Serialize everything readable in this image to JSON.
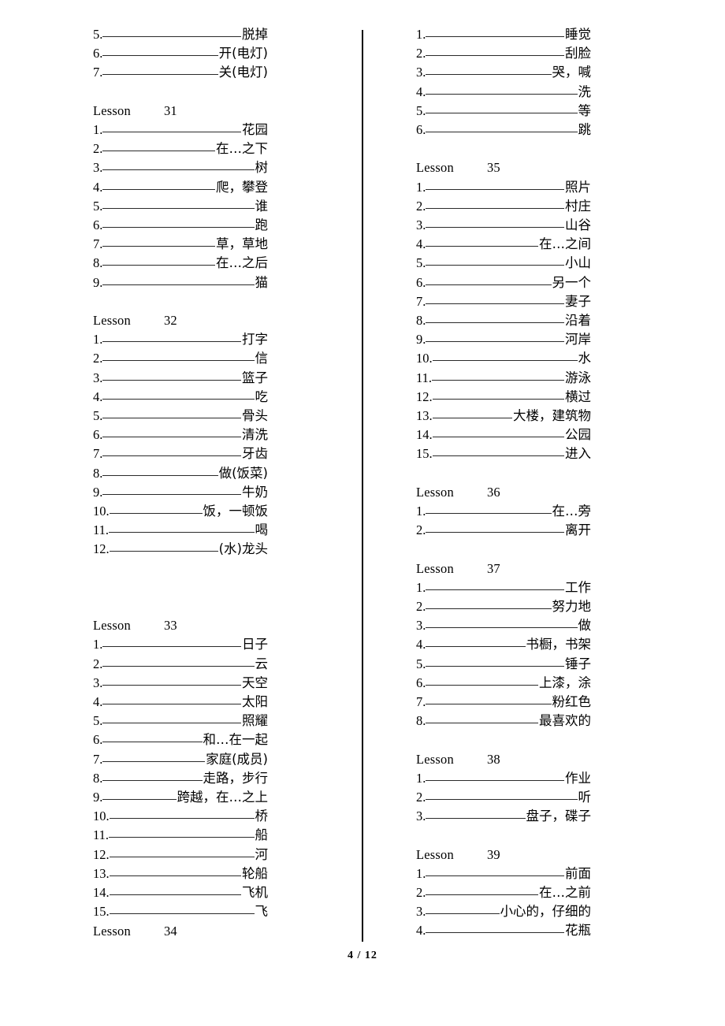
{
  "document": {
    "page_label": "4 / 12",
    "lesson_word": "Lesson"
  },
  "left_column": [
    {
      "type": "entries",
      "heading": null,
      "entries": [
        {
          "num": "5.",
          "gloss": "脱掉"
        },
        {
          "num": "6.",
          "gloss": "开(电灯)"
        },
        {
          "num": "7.",
          "gloss": "关(电灯)"
        }
      ],
      "space_after": 1
    },
    {
      "type": "lesson",
      "heading": {
        "word": "Lesson",
        "number": "31"
      },
      "entries": [
        {
          "num": "1.",
          "gloss": "花园"
        },
        {
          "num": "2.",
          "gloss": "在…之下"
        },
        {
          "num": "3.",
          "gloss": "树"
        },
        {
          "num": "4.",
          "gloss": "爬，攀登"
        },
        {
          "num": "5.",
          "gloss": "谁"
        },
        {
          "num": "6.",
          "gloss": "跑"
        },
        {
          "num": "7.",
          "gloss": "草，草地"
        },
        {
          "num": "8.",
          "gloss": "在…之后"
        },
        {
          "num": "9.",
          "gloss": "猫"
        }
      ],
      "space_after": 1
    },
    {
      "type": "lesson",
      "heading": {
        "word": "Lesson",
        "number": "32"
      },
      "entries": [
        {
          "num": "1.",
          "gloss": "打字"
        },
        {
          "num": "2.",
          "gloss": "信"
        },
        {
          "num": "3.",
          "gloss": "篮子"
        },
        {
          "num": "4.",
          "gloss": "吃"
        },
        {
          "num": "5.",
          "gloss": "骨头"
        },
        {
          "num": "6.",
          "gloss": "清洗"
        },
        {
          "num": "7.",
          "gloss": "牙齿"
        },
        {
          "num": "8.",
          "gloss": "做(饭菜)"
        },
        {
          "num": "9.",
          "gloss": "牛奶"
        },
        {
          "num": "10.",
          "gloss": "饭，一顿饭"
        },
        {
          "num": "11.",
          "gloss": "喝"
        },
        {
          "num": "12.",
          "gloss": "(水)龙头"
        }
      ],
      "space_after": 3
    },
    {
      "type": "lesson",
      "heading": {
        "word": "Lesson",
        "number": "33"
      },
      "entries": [
        {
          "num": "1.",
          "gloss": "日子"
        },
        {
          "num": "2.",
          "gloss": "云"
        },
        {
          "num": "3.",
          "gloss": "天空"
        },
        {
          "num": "4.",
          "gloss": "太阳"
        },
        {
          "num": "5.",
          "gloss": "照耀"
        },
        {
          "num": "6.",
          "gloss": "和…在一起"
        },
        {
          "num": "7.",
          "gloss": "家庭(成员)"
        },
        {
          "num": "8.",
          "gloss": "走路，步行"
        },
        {
          "num": "9.",
          "gloss": "跨越，在…之上"
        },
        {
          "num": "10.",
          "gloss": "桥"
        },
        {
          "num": "11.",
          "gloss": "船"
        },
        {
          "num": "12.",
          "gloss": "河"
        },
        {
          "num": "13.",
          "gloss": "轮船"
        },
        {
          "num": "14.",
          "gloss": "飞机"
        },
        {
          "num": "15.",
          "gloss": "飞"
        }
      ],
      "space_after": 0
    },
    {
      "type": "lesson",
      "heading": {
        "word": "Lesson",
        "number": "34"
      },
      "entries": [],
      "space_after": 0
    }
  ],
  "right_column": [
    {
      "type": "entries",
      "heading": null,
      "entries": [
        {
          "num": "1.",
          "gloss": "睡觉"
        },
        {
          "num": "2.",
          "gloss": "刮脸"
        },
        {
          "num": "3.",
          "gloss": "哭，喊"
        },
        {
          "num": "4.",
          "gloss": "洗"
        },
        {
          "num": "5.",
          "gloss": "等"
        },
        {
          "num": "6.",
          "gloss": "跳"
        }
      ],
      "space_after": 1
    },
    {
      "type": "lesson",
      "heading": {
        "word": "Lesson",
        "number": "35"
      },
      "entries": [
        {
          "num": "1.",
          "gloss": "照片"
        },
        {
          "num": "2.",
          "gloss": "村庄"
        },
        {
          "num": "3.",
          "gloss": "山谷"
        },
        {
          "num": "4.",
          "gloss": "在…之间"
        },
        {
          "num": "5.",
          "gloss": "小山"
        },
        {
          "num": "6.",
          "gloss": "另一个"
        },
        {
          "num": "7.",
          "gloss": "妻子"
        },
        {
          "num": "8.",
          "gloss": "沿着"
        },
        {
          "num": "9.",
          "gloss": "河岸"
        },
        {
          "num": "10.",
          "gloss": "水"
        },
        {
          "num": "11.",
          "gloss": "游泳"
        },
        {
          "num": "12.",
          "gloss": "横过"
        },
        {
          "num": "13.",
          "gloss": "大楼，建筑物"
        },
        {
          "num": "14.",
          "gloss": "公园"
        },
        {
          "num": "15.",
          "gloss": "进入"
        }
      ],
      "space_after": 1
    },
    {
      "type": "lesson",
      "heading": {
        "word": "Lesson",
        "number": "36"
      },
      "entries": [
        {
          "num": "1.",
          "gloss": "在…旁"
        },
        {
          "num": "2.",
          "gloss": "离开"
        }
      ],
      "space_after": 1
    },
    {
      "type": "lesson",
      "heading": {
        "word": "Lesson",
        "number": "37"
      },
      "entries": [
        {
          "num": "1.",
          "gloss": "工作"
        },
        {
          "num": "2.",
          "gloss": "努力地"
        },
        {
          "num": "3.",
          "gloss": "做"
        },
        {
          "num": "4.",
          "gloss": "书橱，书架"
        },
        {
          "num": "5.",
          "gloss": "锤子"
        },
        {
          "num": "6.",
          "gloss": "上漆，涂"
        },
        {
          "num": "7.",
          "gloss": "粉红色"
        },
        {
          "num": "8.",
          "gloss": "最喜欢的"
        }
      ],
      "space_after": 1
    },
    {
      "type": "lesson",
      "heading": {
        "word": "Lesson",
        "number": "38"
      },
      "entries": [
        {
          "num": "1.",
          "gloss": "作业"
        },
        {
          "num": "2.",
          "gloss": "听"
        },
        {
          "num": "3.",
          "gloss": "盘子，碟子"
        }
      ],
      "space_after": 1
    },
    {
      "type": "lesson",
      "heading": {
        "word": "Lesson",
        "number": "39"
      },
      "entries": [
        {
          "num": "1.",
          "gloss": "前面"
        },
        {
          "num": "2.",
          "gloss": "在…之前"
        },
        {
          "num": "3.",
          "gloss": "小心的，仔细的"
        },
        {
          "num": "4.",
          "gloss": "花瓶"
        }
      ],
      "space_after": 0
    }
  ]
}
